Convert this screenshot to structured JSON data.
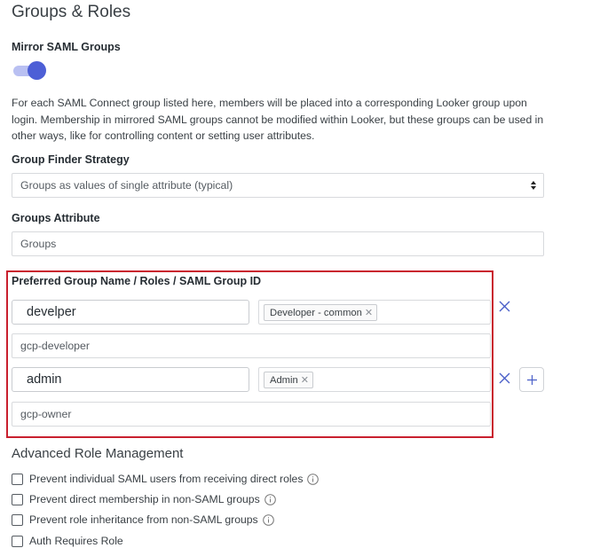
{
  "page": {
    "title": "Groups & Roles"
  },
  "mirror_saml": {
    "label": "Mirror SAML Groups",
    "enabled": true,
    "description": "For each SAML Connect group listed here, members will be placed into a corresponding Looker group upon login. Membership in mirrored SAML groups cannot be modified within Looker, but these groups can be used in other ways, like for controlling content or setting user attributes."
  },
  "group_finder": {
    "label": "Group Finder Strategy",
    "selected": "Groups as values of single attribute (typical)"
  },
  "groups_attribute": {
    "label": "Groups Attribute",
    "value": "Groups"
  },
  "mapping": {
    "label": "Preferred Group Name / Roles / SAML Group ID",
    "rows": [
      {
        "name": "develper",
        "role": "Developer - common",
        "saml_id": "gcp-developer"
      },
      {
        "name": "admin",
        "role": "Admin",
        "saml_id": "gcp-owner"
      }
    ]
  },
  "advanced": {
    "title": "Advanced Role Management",
    "options": [
      {
        "label": "Prevent individual SAML users from receiving direct roles",
        "checked": false,
        "info": true
      },
      {
        "label": "Prevent direct membership in non-SAML groups",
        "checked": false,
        "info": true
      },
      {
        "label": "Prevent role inheritance from non-SAML groups",
        "checked": false,
        "info": true
      },
      {
        "label": "Auth Requires Role",
        "checked": false,
        "info": false
      }
    ]
  },
  "icons": {
    "remove": "close-icon",
    "add": "plus-icon",
    "info": "info-icon",
    "select": "select-arrows-icon"
  },
  "colors": {
    "toggle_on": "#4d5fd6",
    "highlight": "#c9202e"
  }
}
